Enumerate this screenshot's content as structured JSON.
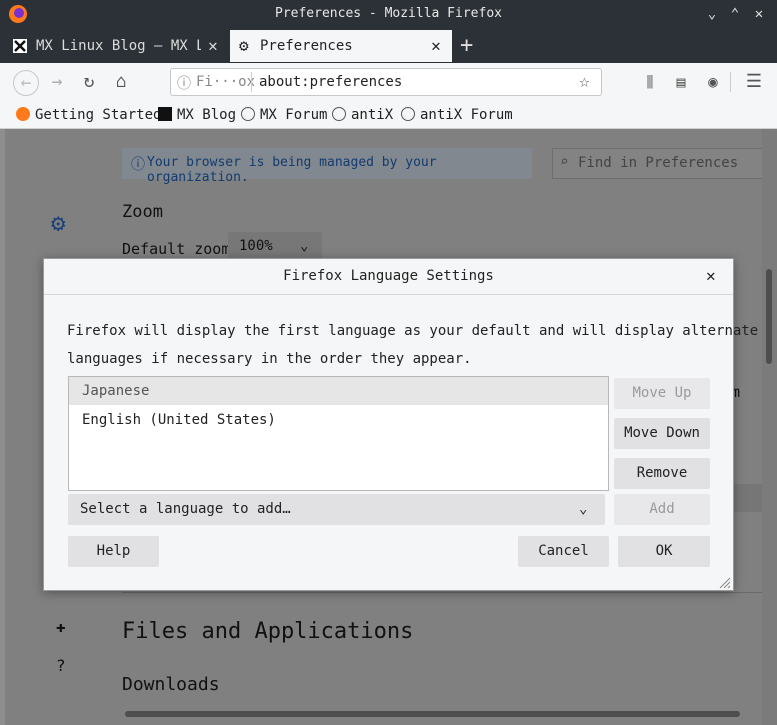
{
  "window": {
    "title": "Preferences - Mozilla Firefox"
  },
  "tabs": [
    {
      "label": "MX Linux Blog – MX Lin",
      "close": "✕"
    },
    {
      "label": "Preferences",
      "close": "✕"
    }
  ],
  "navbar": {
    "url_identity": "Fi···ox",
    "url": "about:preferences"
  },
  "bookmarks": [
    "Getting Started",
    "MX Blog",
    "MX Forum",
    "antiX",
    "antiX Forum"
  ],
  "content": {
    "notice": "Your browser is being managed by your organization.",
    "search_placeholder": "Find in Preferences",
    "zoom_heading": "Zoom",
    "default_zoom_label": "Default zoom",
    "default_zoom_value": "100%",
    "files_heading": "Files and Applications",
    "downloads_heading": "Downloads",
    "partial_text": "m"
  },
  "dialog": {
    "title": "Firefox Language Settings",
    "desc_line1": "Firefox will display the first language as your default and will display alternate",
    "desc_line2": "languages if necessary in the order they appear.",
    "languages": [
      "Japanese",
      "English (United States)"
    ],
    "select_placeholder": "Select a language to add…",
    "buttons": {
      "move_up": "Move Up",
      "move_down": "Move Down",
      "remove": "Remove",
      "add": "Add",
      "help": "Help",
      "cancel": "Cancel",
      "ok": "OK"
    }
  }
}
